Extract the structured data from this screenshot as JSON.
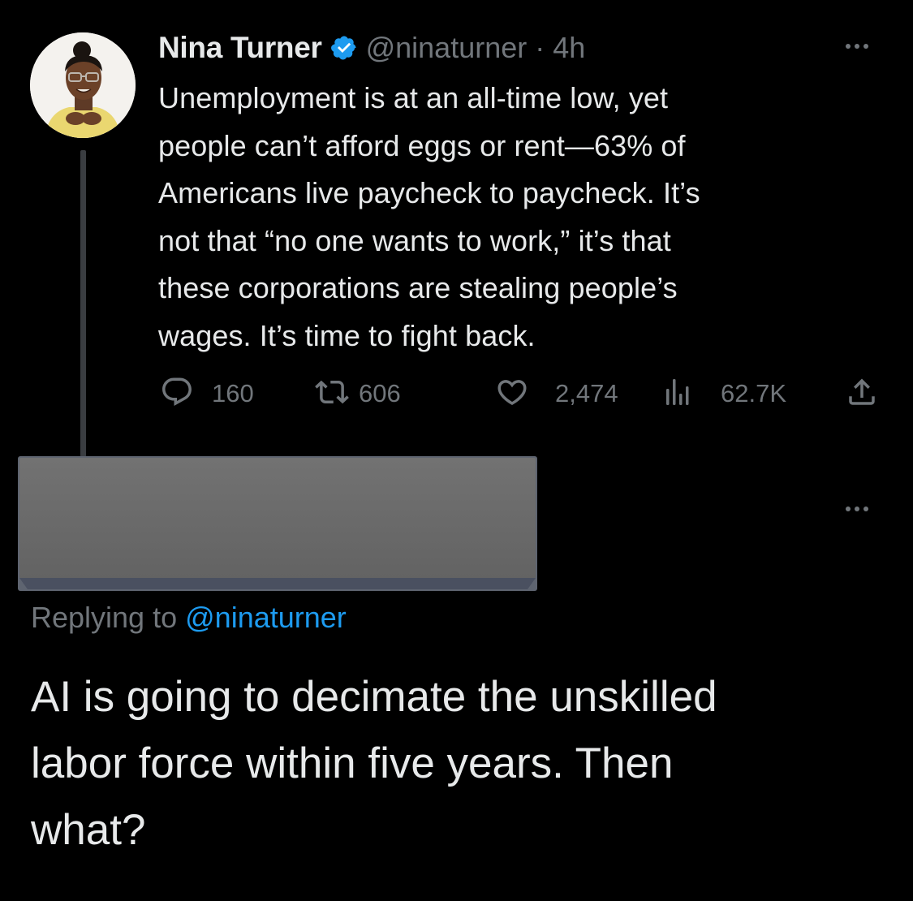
{
  "tweet": {
    "author_name": "Nina Turner",
    "handle_time": "@ninaturner · 4h",
    "text": "Unemployment is at an all-time low, yet\npeople can’t afford eggs or rent—63% of\nAmericans live paycheck to paycheck. It’s\nnot that “no one wants to work,” it’s that\nthese corporations are stealing people’s\nwages. It’s time to fight back.",
    "stats": {
      "replies": "160",
      "retweets": "606",
      "likes": "2,474",
      "views": "62.7K"
    },
    "icons": {
      "verified": "verified-badge-icon",
      "more": "more-options-icon",
      "reply": "reply-icon",
      "retweet": "retweet-icon",
      "like": "like-icon",
      "views": "views-icon",
      "share": "share-icon"
    }
  },
  "reply": {
    "replying_to_label": "Replying to",
    "replying_to_handle": "@ninaturner",
    "text": "AI is going to decimate the unskilled\nlabor force within five years. Then\nwhat?",
    "author_redacted": true
  },
  "colors": {
    "background": "#000000",
    "text_primary": "#e7e9ea",
    "text_secondary": "#71767b",
    "accent": "#1d9bf0",
    "redaction_gray": "#6b6b6b"
  }
}
